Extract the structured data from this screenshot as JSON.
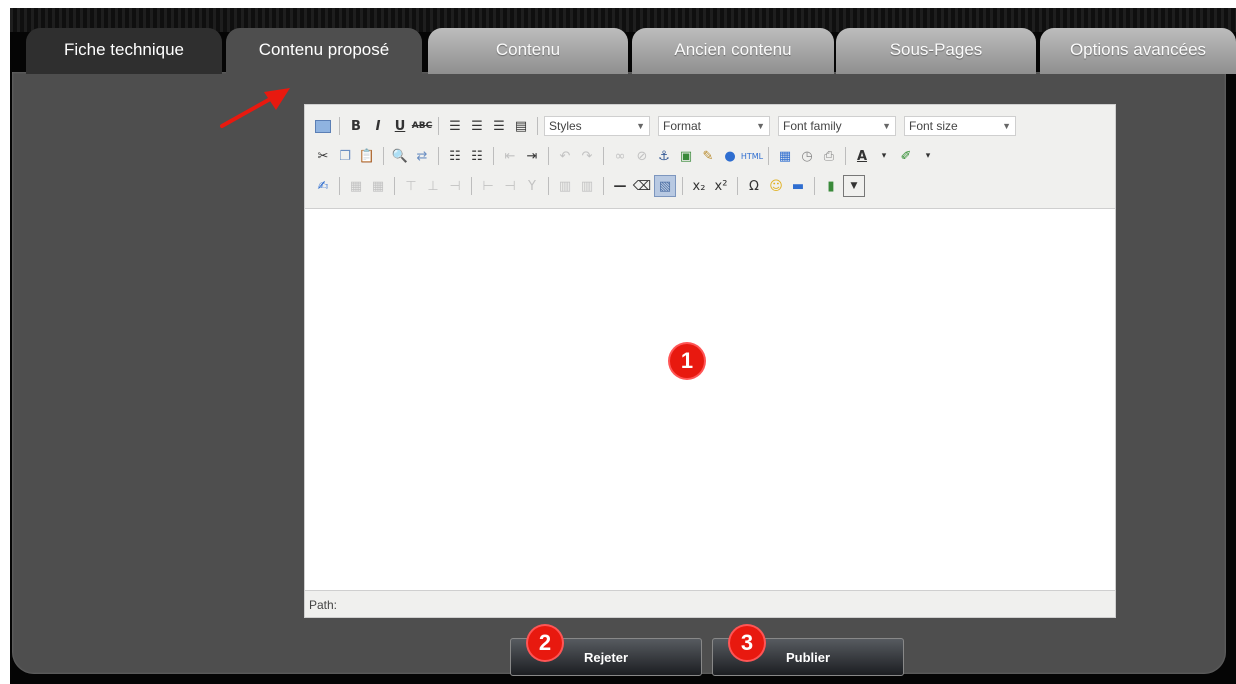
{
  "tabs": [
    {
      "label": "Fiche technique"
    },
    {
      "label": "Contenu proposé"
    },
    {
      "label": "Contenu"
    },
    {
      "label": "Ancien contenu"
    },
    {
      "label": "Sous-Pages"
    },
    {
      "label": "Options avancées"
    }
  ],
  "editor": {
    "selects": {
      "styles": "Styles",
      "format": "Format",
      "font_family": "Font family",
      "font_size": "Font size"
    },
    "path_label": "Path:"
  },
  "badges": {
    "one": "1",
    "two": "2",
    "three": "3"
  },
  "actions": {
    "reject": "Rejeter",
    "publish": "Publier"
  },
  "colors": {
    "badge": "#e8190f",
    "arrow": "#e8190f",
    "panel": "#4e4e4e"
  }
}
